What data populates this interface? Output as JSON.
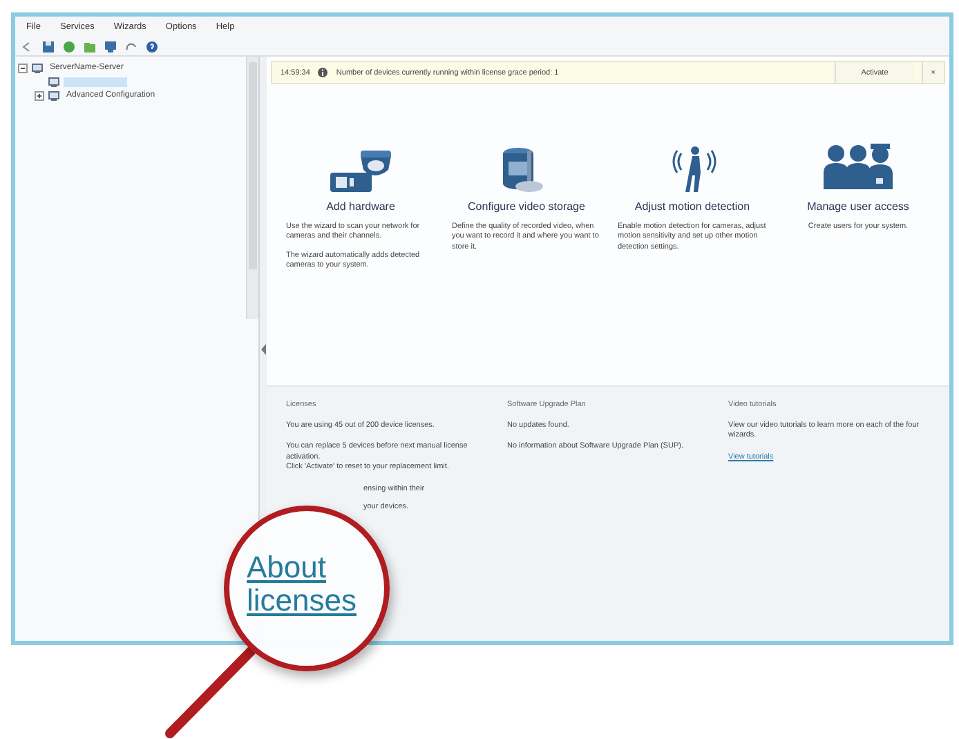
{
  "menu": [
    "File",
    "Services",
    "Wizards",
    "Options",
    "Help"
  ],
  "tree": [
    {
      "label": "ServerName-Server",
      "expanded": true,
      "selected": false,
      "children": [
        {
          "selected": true
        },
        {
          "label": "Advanced Configuration",
          "expanded": false,
          "selected": false
        }
      ]
    }
  ],
  "notice": {
    "time": "14:59:34",
    "message": "Number of devices currently running within license grace period: 1",
    "button": "Activate",
    "close": "×"
  },
  "wizards": [
    {
      "kind": "hardware",
      "title": "Add hardware",
      "paragraphs": [
        "Use the wizard to scan your network for cameras and their channels.",
        "The wizard automatically adds detected cameras to your system."
      ]
    },
    {
      "kind": "storage",
      "title": "Configure video storage",
      "paragraphs": [
        "Define the quality of recorded video, when you want to record it and where you want to store it."
      ]
    },
    {
      "kind": "motion",
      "title": "Adjust motion detection",
      "paragraphs": [
        "Enable motion detection for cameras, adjust motion sensitivity and set up other motion detection settings."
      ]
    },
    {
      "kind": "users",
      "title": "Manage user access",
      "paragraphs": [
        "Create users for your system."
      ]
    }
  ],
  "info": [
    {
      "heading": "Licenses",
      "items": [
        {
          "kind": "text",
          "text": "You are using 45 out of 200 device licenses."
        },
        {
          "kind": "text",
          "text": "You can replace 5 devices before next manual license activation.\nClick 'Activate' to reset to your replacement limit."
        },
        {
          "kind": "text",
          "text": "ensing within their"
        },
        {
          "kind": "text",
          "text": "your devices."
        }
      ]
    },
    {
      "heading": "Software Upgrade Plan",
      "items": [
        {
          "kind": "text",
          "text": "No updates found."
        },
        {
          "kind": "text",
          "text": "No information about Software Upgrade Plan (SUP)."
        }
      ]
    },
    {
      "heading": "Video tutorials",
      "items": [
        {
          "kind": "text",
          "text": "View our video tutorials to learn more on each of the four wizards."
        },
        {
          "kind": "link",
          "text": "View tutorials"
        }
      ]
    }
  ],
  "magnifier": {
    "link": "About licenses"
  }
}
